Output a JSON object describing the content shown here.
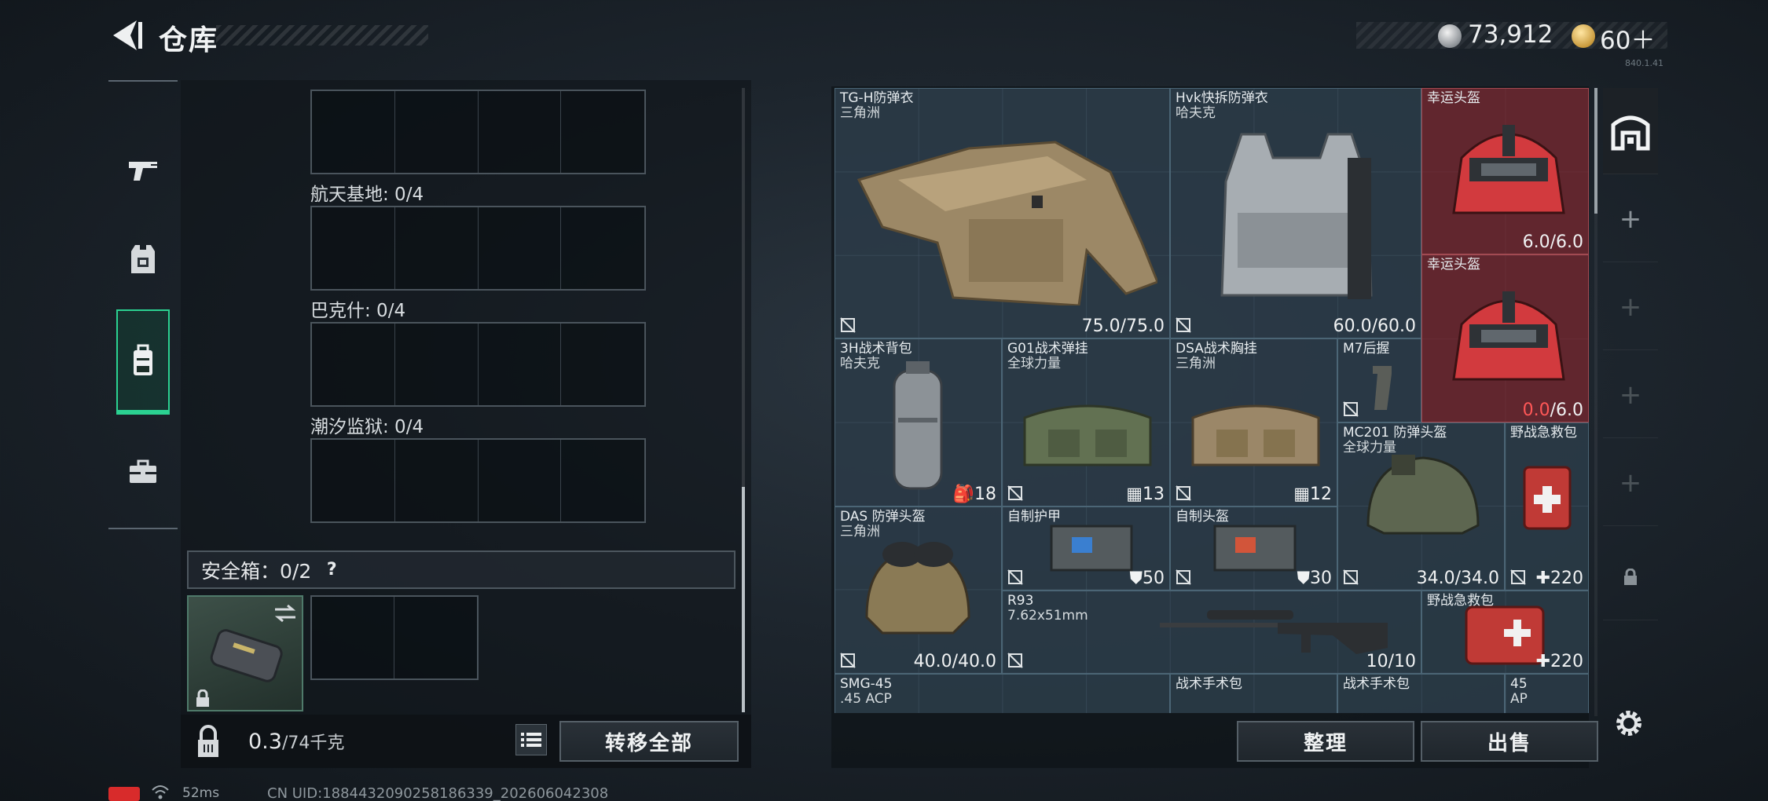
{
  "header": {
    "title": "仓库",
    "currency": {
      "silver": "73,912",
      "gold": "60＋"
    },
    "version": "840.1.41"
  },
  "left_rail": {
    "items": [
      {
        "icon": "pistol-icon"
      },
      {
        "icon": "armor-vest-icon"
      },
      {
        "icon": "backpack-icon",
        "active": true
      },
      {
        "icon": "toolbox-icon"
      }
    ]
  },
  "containers": {
    "sections": [
      {
        "label": "航天基地: 0/4"
      },
      {
        "label": "巴克什: 0/4"
      },
      {
        "label": "潮汐监狱: 0/4"
      }
    ],
    "safe_box_label": "安全箱：0/2",
    "safe_box_help": "?"
  },
  "footer": {
    "weight_value": "0.3",
    "weight_capacity": "/74千克",
    "transfer_all": "转移全部",
    "sort": "整理",
    "sell": "出售"
  },
  "stash_items": [
    {
      "name": "TG-H防弹衣",
      "sub": "三角洲",
      "value": "75.0/75.0"
    },
    {
      "name": "Hvk快拆防弹衣",
      "sub": "哈夫克",
      "value": "60.0/60.0"
    },
    {
      "name": "幸运头盔",
      "value": "6.0/6.0"
    },
    {
      "name": "幸运头盔",
      "value_a": "0.0",
      "value_b": "/6.0"
    },
    {
      "name": "3H战术背包",
      "sub": "哈夫克",
      "value": "18"
    },
    {
      "name": "G01战术弹挂",
      "sub": "全球力量",
      "value": "13"
    },
    {
      "name": "DSA战术胸挂",
      "sub": "三角洲",
      "value": "12"
    },
    {
      "name": "M7后握"
    },
    {
      "name": "MC201 防弹头盔",
      "sub": "全球力量",
      "value": "34.0/34.0"
    },
    {
      "name": "野战急救包",
      "value": "220"
    },
    {
      "name": "DAS 防弹头盔",
      "sub": "三角洲",
      "value": "40.0/40.0"
    },
    {
      "name": "自制护甲",
      "value": "50"
    },
    {
      "name": "自制头盔",
      "value": "30"
    },
    {
      "name": "R93",
      "sub": "7.62x51mm",
      "value": "10/10"
    },
    {
      "name": "野战急救包",
      "value": "220"
    },
    {
      "name": "SMG-45",
      "sub": ".45 ACP"
    },
    {
      "name": "战术手术包"
    },
    {
      "name": "战术手术包"
    },
    {
      "name": "45",
      "sub": "AP"
    }
  ],
  "status_bar": {
    "ping": "52ms",
    "uid": "CN UID:1884432090258186339_202606042308"
  },
  "colors": {
    "accent": "#2bd191",
    "danger": "#ff5757",
    "highlight_red": "#a24a52"
  }
}
